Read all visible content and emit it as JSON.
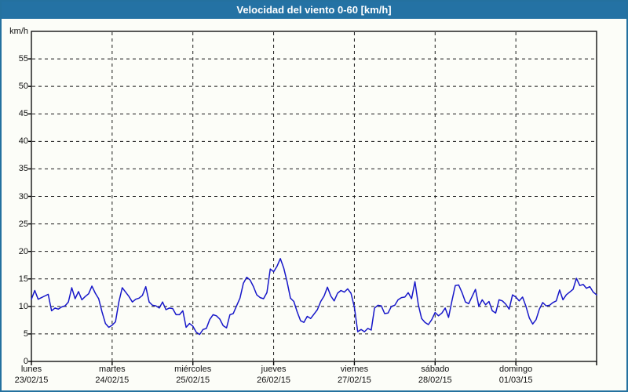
{
  "window": {
    "title": "Velocidad del viento 0-60 [km/h]"
  },
  "colors": {
    "titlebar_bg": "#2472a4",
    "titlebar_text": "#ffffff",
    "frame_border": "#24719f",
    "page_bg": "#fcfdf8",
    "grid": "#1a1a1a",
    "line": "#1717c9",
    "label_text": "#111111"
  },
  "chart_data": {
    "type": "line",
    "title": "Velocidad del viento 0-60 [km/h]",
    "y_unit_label": "km/h",
    "ylabel": "km/h",
    "xlabel": "",
    "ylim": [
      0,
      60
    ],
    "y_ticks": [
      0,
      5,
      10,
      15,
      20,
      25,
      30,
      35,
      40,
      45,
      50,
      55
    ],
    "grid": "dashed-black-horizontal-and-vertical",
    "legend_position": "none",
    "days": [
      {
        "name": "lunes",
        "date": "23/02/15"
      },
      {
        "name": "martes",
        "date": "24/02/15"
      },
      {
        "name": "miércoles",
        "date": "25/02/15"
      },
      {
        "name": "jueves",
        "date": "26/02/15"
      },
      {
        "name": "viernes",
        "date": "27/02/15"
      },
      {
        "name": "sábado",
        "date": "28/02/15"
      },
      {
        "name": "domingo",
        "date": "01/03/15"
      }
    ],
    "points_per_day": 24,
    "series": [
      {
        "name": "velocidad del viento [km/h]",
        "values": [
          11.3,
          12.9,
          11.3,
          11.6,
          11.9,
          12.2,
          9.2,
          9.7,
          9.5,
          9.9,
          10.1,
          10.8,
          13.4,
          11.4,
          12.7,
          11.2,
          11.8,
          12.3,
          13.7,
          12.4,
          11.4,
          9.0,
          6.9,
          6.2,
          6.6,
          7.2,
          10.8,
          13.4,
          12.6,
          11.8,
          10.8,
          11.3,
          11.5,
          12.0,
          13.6,
          10.8,
          10.2,
          10.1,
          9.7,
          10.8,
          9.4,
          9.7,
          9.6,
          8.5,
          8.5,
          9.2,
          6.2,
          6.9,
          6.4,
          5.3,
          4.9,
          5.8,
          6.0,
          7.6,
          8.5,
          8.3,
          7.7,
          6.5,
          6.1,
          8.5,
          8.7,
          10.1,
          11.5,
          14.2,
          15.3,
          14.8,
          13.6,
          12.1,
          11.6,
          11.4,
          12.5,
          16.8,
          16.3,
          17.3,
          18.7,
          17.0,
          14.5,
          11.5,
          10.9,
          9.0,
          7.4,
          7.1,
          8.2,
          7.8,
          8.6,
          9.4,
          10.9,
          11.9,
          13.5,
          11.9,
          11.0,
          12.4,
          12.9,
          12.6,
          13.2,
          12.4,
          9.9,
          5.4,
          5.8,
          5.4,
          6.0,
          5.7,
          9.7,
          10.2,
          10.1,
          8.7,
          8.8,
          10.0,
          10.2,
          11.2,
          11.6,
          11.7,
          12.5,
          11.4,
          14.5,
          10.3,
          7.8,
          7.1,
          6.7,
          7.6,
          8.9,
          8.3,
          8.8,
          9.7,
          8.0,
          11.0,
          13.8,
          13.9,
          12.5,
          10.8,
          10.5,
          11.8,
          13.1,
          10.0,
          11.2,
          10.3,
          10.9,
          9.2,
          8.8,
          11.2,
          11.0,
          10.4,
          9.5,
          12.1,
          11.7,
          11.0,
          11.7,
          10.0,
          7.9,
          6.8,
          7.6,
          9.5,
          10.7,
          10.1,
          10.2,
          10.7,
          11.0,
          13.0,
          11.2,
          12.1,
          12.6,
          13.1,
          15.1,
          13.8,
          14.0,
          13.3,
          13.6,
          12.6,
          12.1
        ]
      }
    ]
  }
}
